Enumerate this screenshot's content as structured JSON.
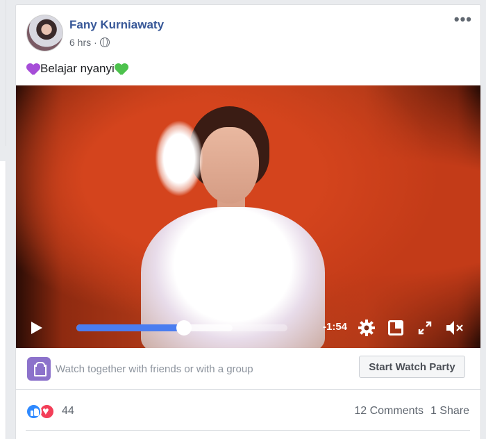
{
  "post": {
    "author": "Fany Kurniawaty",
    "time": "6 hrs",
    "separator": "·",
    "privacy_icon": "globe-icon",
    "more_label": "•••",
    "text": "Belajar nyanyi",
    "emoji_before": "purple-heart",
    "emoji_after": "green-heart"
  },
  "video": {
    "progress": 0.51,
    "buffered": 0.74,
    "remaining_time": "-1:54",
    "controls": [
      "play-icon",
      "gear-icon",
      "picture-in-picture-icon",
      "fullscreen-icon",
      "volume-muted-icon"
    ]
  },
  "watch_party": {
    "prompt": "Watch together with friends or with a group",
    "button_label": "Start Watch Party"
  },
  "reactions": {
    "types": [
      "like",
      "love"
    ],
    "count": "44",
    "comments": "12 Comments",
    "shares": "1 Share"
  },
  "colors": {
    "author_link": "#385898",
    "progress_fill": "#4a7df0",
    "watch_party_icon": "#8c72cb",
    "like": "#2e89ff",
    "love": "#f33e58"
  }
}
